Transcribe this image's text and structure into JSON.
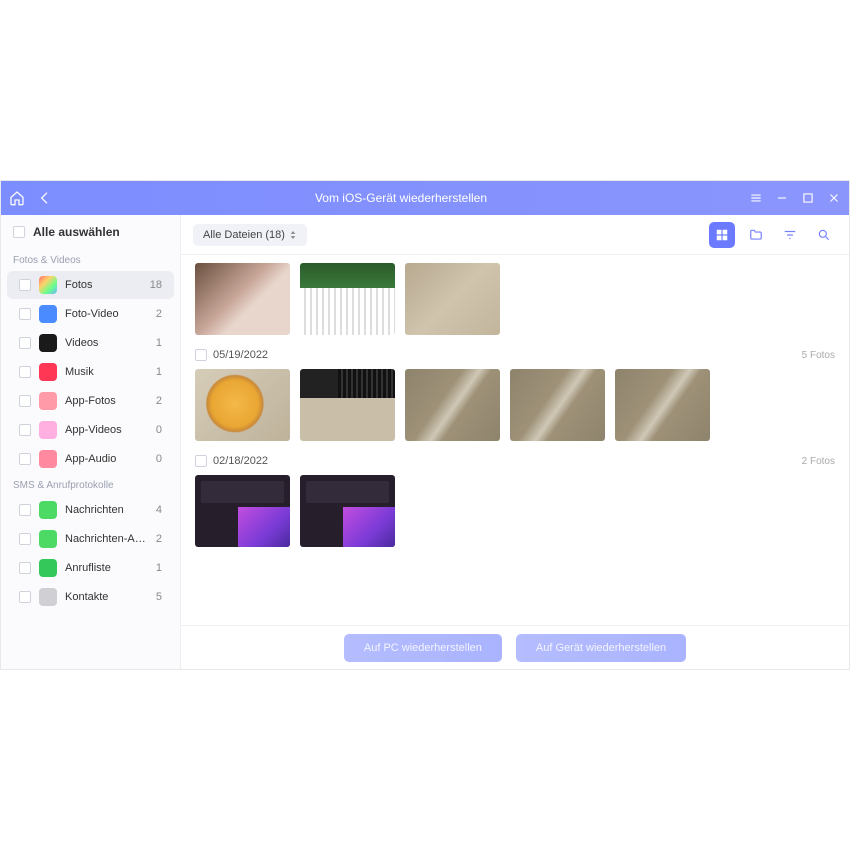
{
  "titlebar": {
    "title": "Vom iOS-Gerät wiederherstellen"
  },
  "sidebar": {
    "select_all": "Alle auswählen",
    "sections": [
      {
        "label": "Fotos & Videos",
        "items": [
          {
            "id": "fotos",
            "label": "Fotos",
            "count": 18,
            "active": true,
            "icon_bg": "linear-gradient(135deg,#ff6a6a,#ffd36a,#6aff8a,#6ab6ff)"
          },
          {
            "id": "foto-video",
            "label": "Foto-Video",
            "count": 2,
            "icon_bg": "#4a8cff"
          },
          {
            "id": "videos",
            "label": "Videos",
            "count": 1,
            "icon_bg": "#1a1a1a"
          },
          {
            "id": "musik",
            "label": "Musik",
            "count": 1,
            "icon_bg": "#ff3654"
          },
          {
            "id": "app-fotos",
            "label": "App-Fotos",
            "count": 2,
            "icon_bg": "#ff9aa8"
          },
          {
            "id": "app-videos",
            "label": "App-Videos",
            "count": 0,
            "icon_bg": "#ffb0e0"
          },
          {
            "id": "app-audio",
            "label": "App-Audio",
            "count": 0,
            "icon_bg": "#ff8aa0"
          }
        ]
      },
      {
        "label": "SMS & Anrufprotokolle",
        "items": [
          {
            "id": "nachrichten",
            "label": "Nachrichten",
            "count": 4,
            "icon_bg": "#4cd964"
          },
          {
            "id": "nachrichten-anlagen",
            "label": "Nachrichten-Anlagen",
            "count": 2,
            "icon_bg": "#4cd964"
          },
          {
            "id": "anrufliste",
            "label": "Anrufliste",
            "count": 1,
            "icon_bg": "#34c759"
          },
          {
            "id": "kontakte",
            "label": "Kontakte",
            "count": 5,
            "icon_bg": "#cfcfd4"
          }
        ]
      }
    ]
  },
  "topbar": {
    "filter_label": "Alle Dateien (18)"
  },
  "groups": [
    {
      "date": "",
      "count_label": "",
      "thumbs": [
        "a",
        "b",
        "c"
      ]
    },
    {
      "date": "05/19/2022",
      "count_label": "5 Fotos",
      "thumbs": [
        "d",
        "e",
        "f",
        "f",
        "f"
      ]
    },
    {
      "date": "02/18/2022",
      "count_label": "2 Fotos",
      "thumbs": [
        "g",
        "g"
      ]
    }
  ],
  "footer": {
    "restore_pc": "Auf PC wiederherstellen",
    "restore_device": "Auf Gerät wiederherstellen"
  }
}
